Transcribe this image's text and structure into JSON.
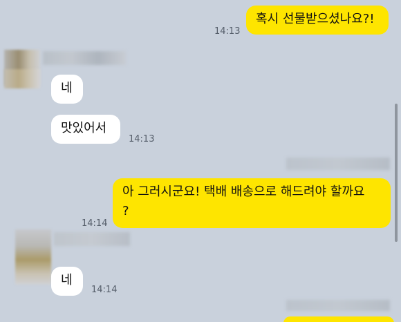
{
  "messages": [
    {
      "id": "m1",
      "dir": "out",
      "text": "혹시 선물받으셨나요?!",
      "time": "14:13"
    },
    {
      "id": "m2",
      "dir": "in",
      "text": "네",
      "time": ""
    },
    {
      "id": "m3",
      "dir": "in",
      "text": "맛있어서",
      "time": "14:13"
    },
    {
      "id": "m4",
      "dir": "out",
      "text": "아 그러시군요! 택배 배송으로 해드려야 할까요\n?",
      "time": "14:14"
    },
    {
      "id": "m5",
      "dir": "in",
      "text": "네",
      "time": "14:14"
    }
  ],
  "colors": {
    "background": "#c9d1dc",
    "outgoing_bubble": "#fee500",
    "incoming_bubble": "#ffffff"
  }
}
